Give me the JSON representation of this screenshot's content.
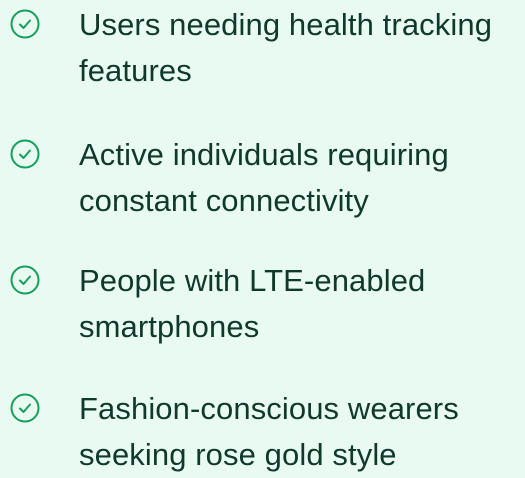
{
  "colors": {
    "background": "#e9faf3",
    "text": "#0f3a2b",
    "icon": "#14a05a"
  },
  "benefits": {
    "items": [
      {
        "icon": "check-circle-icon",
        "label": "Users needing health tracking features"
      },
      {
        "icon": "check-circle-icon",
        "label": "Active individuals requiring constant connectivity"
      },
      {
        "icon": "check-circle-icon",
        "label": "People with LTE-enabled smartphones"
      },
      {
        "icon": "check-circle-icon",
        "label": "Fashion-conscious wearers seeking rose gold style"
      }
    ]
  }
}
